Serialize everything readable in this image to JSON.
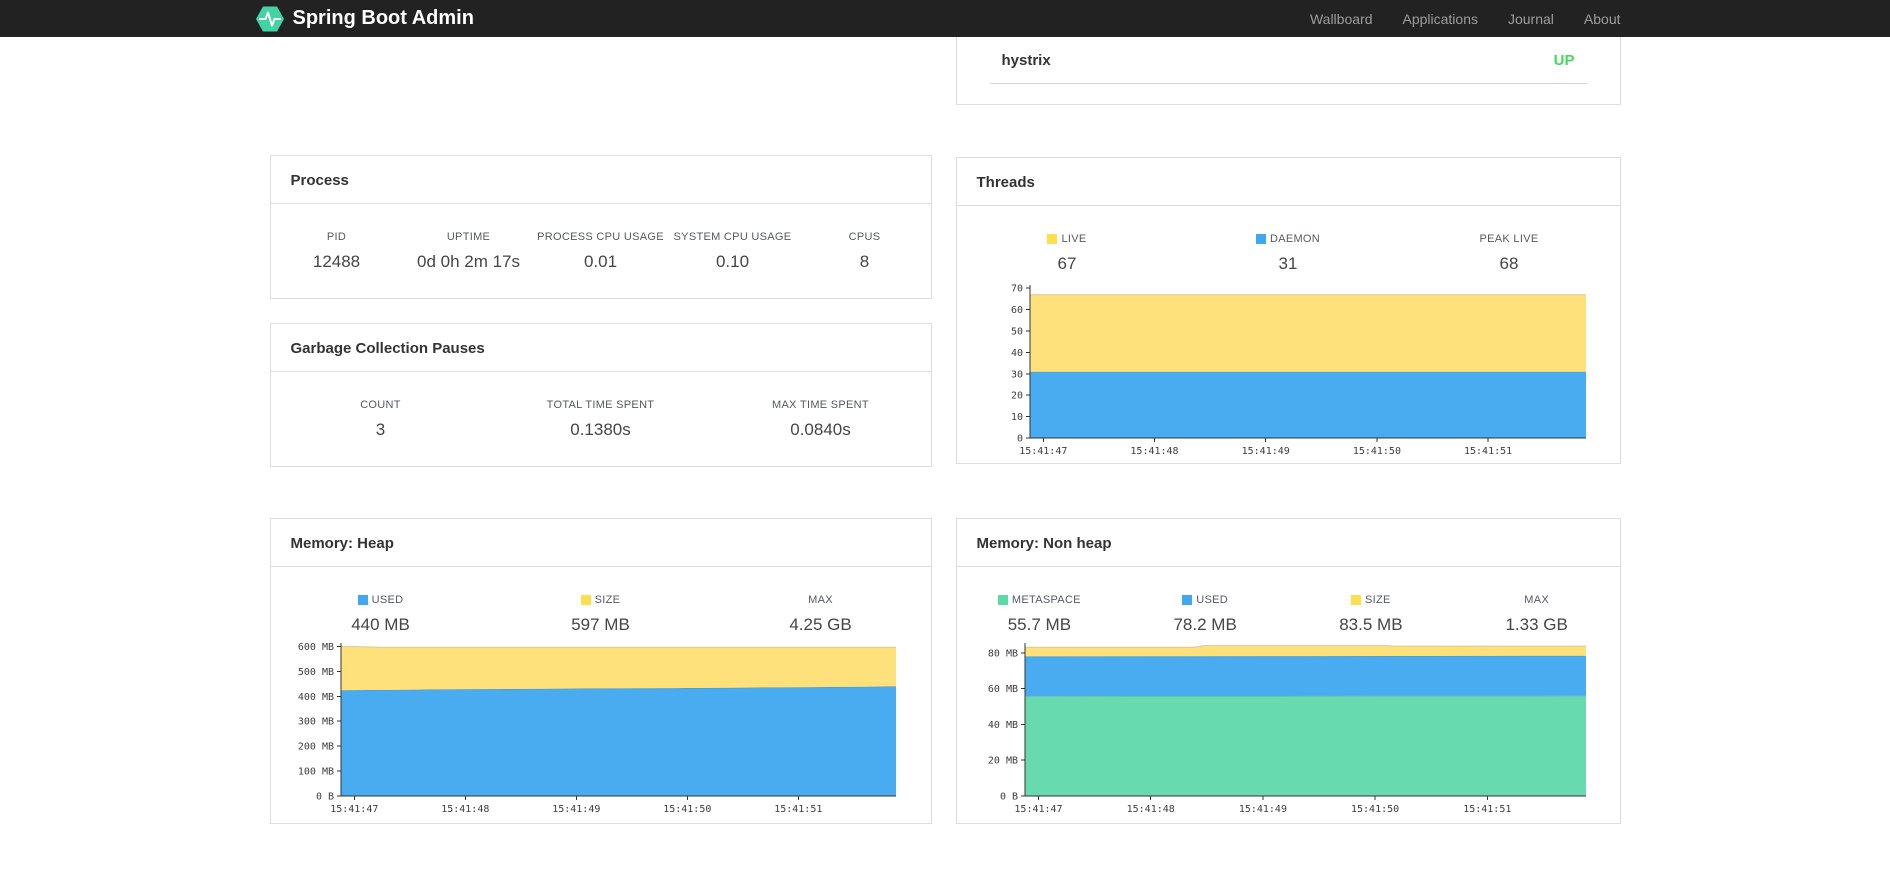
{
  "navbar": {
    "brand": "Spring Boot Admin",
    "links": [
      {
        "label": "Wallboard"
      },
      {
        "label": "Applications"
      },
      {
        "label": "Journal"
      },
      {
        "label": "About"
      }
    ]
  },
  "status_card": {
    "app_name": "hystrix",
    "status": "UP",
    "status_color": "#44d75c"
  },
  "cards": {
    "process": {
      "title": "Process",
      "metrics": [
        {
          "label": "PID",
          "value": "12488",
          "color": null
        },
        {
          "label": "UPTIME",
          "value": "0d 0h 2m 17s",
          "color": null
        },
        {
          "label": "PROCESS CPU USAGE",
          "value": "0.01",
          "color": null
        },
        {
          "label": "SYSTEM CPU USAGE",
          "value": "0.10",
          "color": null
        },
        {
          "label": "CPUS",
          "value": "8",
          "color": null
        }
      ]
    },
    "gc": {
      "title": "Garbage Collection Pauses",
      "metrics": [
        {
          "label": "COUNT",
          "value": "3",
          "color": null
        },
        {
          "label": "TOTAL TIME SPENT",
          "value": "0.1380s",
          "color": null
        },
        {
          "label": "MAX TIME SPENT",
          "value": "0.0840s",
          "color": null
        }
      ]
    },
    "threads": {
      "title": "Threads",
      "metrics": [
        {
          "label": "LIVE",
          "value": "67",
          "color": "#FBDF4F"
        },
        {
          "label": "DAEMON",
          "value": "31",
          "color": "#41A8F0"
        },
        {
          "label": "PEAK LIVE",
          "value": "68",
          "color": null
        }
      ]
    },
    "heap": {
      "title": "Memory: Heap",
      "metrics": [
        {
          "label": "USED",
          "value": "440 MB",
          "color": "#41A8F0"
        },
        {
          "label": "SIZE",
          "value": "597 MB",
          "color": "#FBDF4F"
        },
        {
          "label": "MAX",
          "value": "4.25 GB",
          "color": null
        }
      ]
    },
    "nonheap": {
      "title": "Memory: Non heap",
      "metrics": [
        {
          "label": "METASPACE",
          "value": "55.7 MB",
          "color": "#5BD9A9"
        },
        {
          "label": "USED",
          "value": "78.2 MB",
          "color": "#41A8F0"
        },
        {
          "label": "SIZE",
          "value": "83.5 MB",
          "color": "#FBDF4F"
        },
        {
          "label": "MAX",
          "value": "1.33 GB",
          "color": null
        }
      ]
    }
  },
  "chart_data": [
    {
      "id": "threads-chart",
      "type": "area",
      "title": "Threads",
      "stacked": true,
      "values_are_cumulative_tops": true,
      "x_domain": [
        0,
        5
      ],
      "x_ticks": [
        {
          "v": 0.12,
          "label": "15:41:47"
        },
        {
          "v": 1.12,
          "label": "15:41:48"
        },
        {
          "v": 2.12,
          "label": "15:41:49"
        },
        {
          "v": 3.12,
          "label": "15:41:50"
        },
        {
          "v": 4.12,
          "label": "15:41:51"
        }
      ],
      "ylim": [
        0,
        71.5
      ],
      "y_ticks": [
        {
          "v": 0,
          "label": "0"
        },
        {
          "v": 10,
          "label": "10"
        },
        {
          "v": 20,
          "label": "20"
        },
        {
          "v": 30,
          "label": "30"
        },
        {
          "v": 40,
          "label": "40"
        },
        {
          "v": 50,
          "label": "50"
        },
        {
          "v": 60,
          "label": "60"
        },
        {
          "v": 70,
          "label": "70"
        }
      ],
      "series": [
        {
          "name": "DAEMON",
          "color": "#4AACF0",
          "points": [
            [
              0,
              31
            ],
            [
              5,
              31
            ]
          ]
        },
        {
          "name": "LIVE",
          "color": "#FFE17C",
          "points": [
            [
              0,
              67
            ],
            [
              5,
              67
            ]
          ]
        }
      ]
    },
    {
      "id": "heap-chart",
      "type": "area",
      "title": "Memory: Heap",
      "stacked": true,
      "values_are_cumulative_tops": true,
      "x_domain": [
        0,
        5
      ],
      "x_ticks": [
        {
          "v": 0.12,
          "label": "15:41:47"
        },
        {
          "v": 1.12,
          "label": "15:41:48"
        },
        {
          "v": 2.12,
          "label": "15:41:49"
        },
        {
          "v": 3.12,
          "label": "15:41:50"
        },
        {
          "v": 4.12,
          "label": "15:41:51"
        }
      ],
      "ylim": [
        0,
        614
      ],
      "y_ticks": [
        {
          "v": 0,
          "label": "0 B"
        },
        {
          "v": 100,
          "label": "100 MB"
        },
        {
          "v": 200,
          "label": "200 MB"
        },
        {
          "v": 300,
          "label": "300 MB"
        },
        {
          "v": 400,
          "label": "400 MB"
        },
        {
          "v": 500,
          "label": "500 MB"
        },
        {
          "v": 600,
          "label": "600 MB"
        }
      ],
      "series": [
        {
          "name": "USED",
          "color": "#4AACF0",
          "points": [
            [
              0,
              424
            ],
            [
              1,
              428
            ],
            [
              2,
              431
            ],
            [
              3,
              433
            ],
            [
              4,
              436
            ],
            [
              5,
              440
            ]
          ]
        },
        {
          "name": "SIZE",
          "color": "#FFE17C",
          "points": [
            [
              0,
              601
            ],
            [
              0.4,
              597
            ],
            [
              5,
              597
            ]
          ]
        }
      ]
    },
    {
      "id": "nonheap-chart",
      "type": "area",
      "title": "Memory: Non heap",
      "stacked": true,
      "values_are_cumulative_tops": true,
      "x_domain": [
        0,
        5
      ],
      "x_ticks": [
        {
          "v": 0.12,
          "label": "15:41:47"
        },
        {
          "v": 1.12,
          "label": "15:41:48"
        },
        {
          "v": 2.12,
          "label": "15:41:49"
        },
        {
          "v": 3.12,
          "label": "15:41:50"
        },
        {
          "v": 4.12,
          "label": "15:41:51"
        }
      ],
      "ylim": [
        0,
        85.5
      ],
      "y_ticks": [
        {
          "v": 0,
          "label": "0 B"
        },
        {
          "v": 20,
          "label": "20 MB"
        },
        {
          "v": 40,
          "label": "40 MB"
        },
        {
          "v": 60,
          "label": "60 MB"
        },
        {
          "v": 80,
          "label": "80 MB"
        }
      ],
      "series": [
        {
          "name": "METASPACE",
          "color": "#67DBAF",
          "points": [
            [
              0,
              55.8
            ],
            [
              5,
              56
            ]
          ]
        },
        {
          "name": "USED",
          "color": "#4AACF0",
          "points": [
            [
              0,
              78
            ],
            [
              2.5,
              78.2
            ],
            [
              5,
              78.4
            ]
          ]
        },
        {
          "name": "SIZE",
          "color": "#FFE17C",
          "points": [
            [
              0,
              83.2
            ],
            [
              1.5,
              83.2
            ],
            [
              1.6,
              84.1
            ],
            [
              3.2,
              84.1
            ],
            [
              3.3,
              83.8
            ],
            [
              5,
              83.8
            ]
          ]
        }
      ]
    }
  ],
  "colors": {
    "navbar_bg": "#222222",
    "brand_logo_green": "#42d3a5",
    "status_up_green": "#44d75c",
    "series_blue": "#4AACF0",
    "series_yellow": "#FFE17C",
    "series_green": "#67DBAF",
    "card_border": "#dddddd"
  }
}
